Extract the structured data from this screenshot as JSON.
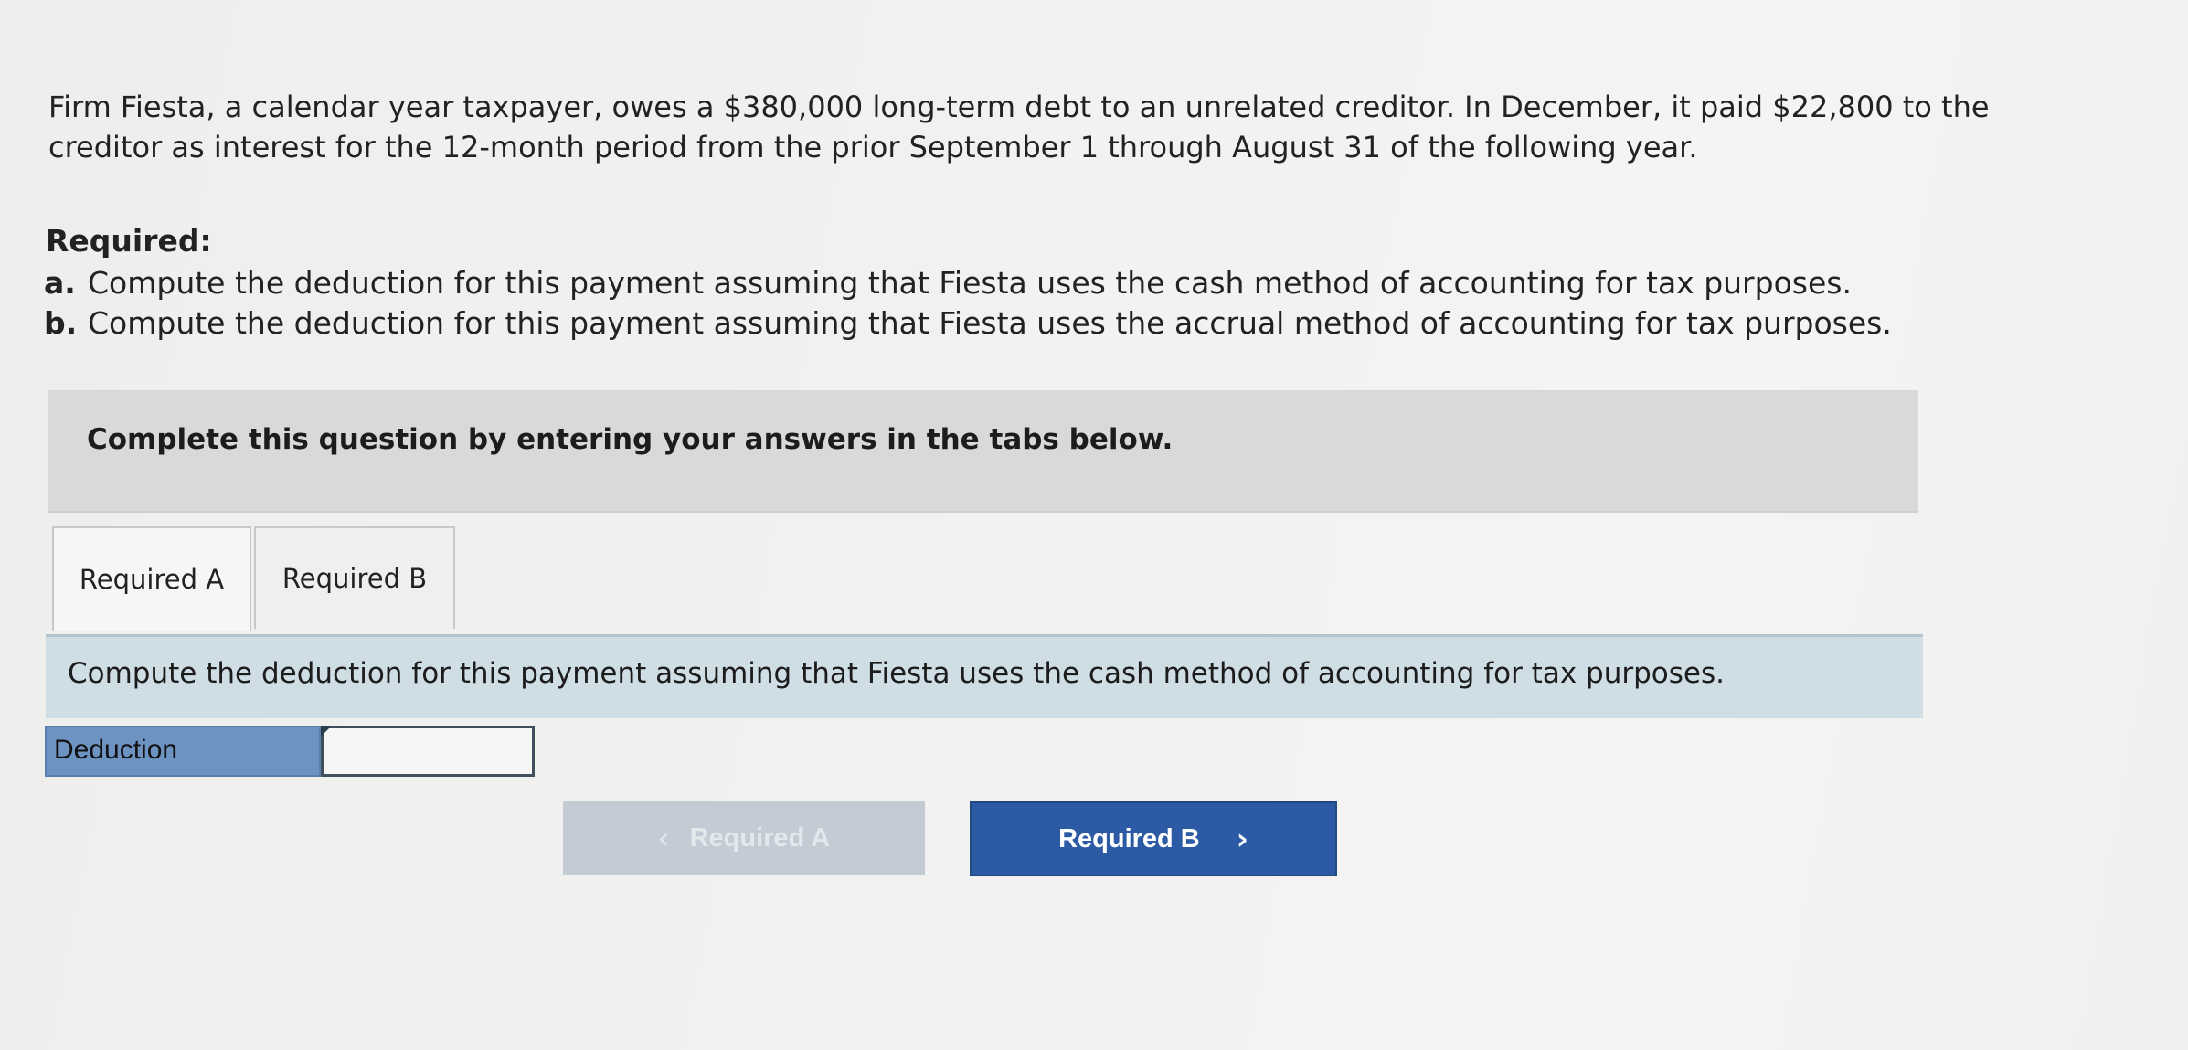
{
  "problem": {
    "line1": "Firm Fiesta, a calendar year taxpayer, owes a $380,000 long-term debt to an unrelated creditor. In December, it paid $22,800 to the",
    "line2": "creditor as interest for the 12-month period from the prior September 1 through August 31 of the following year."
  },
  "required": {
    "heading": "Required:",
    "items": [
      {
        "letter": "a.",
        "text": "Compute the deduction for this payment assuming that Fiesta uses the cash method of accounting for tax purposes."
      },
      {
        "letter": "b.",
        "text": "Compute the deduction for this payment assuming that Fiesta uses the accrual method of accounting for tax purposes."
      }
    ]
  },
  "instruction": "Complete this question by entering your answers in the tabs below.",
  "tabs": [
    {
      "label": "Required A",
      "active": true
    },
    {
      "label": "Required B",
      "active": false
    }
  ],
  "task": "Compute the deduction for this payment assuming that Fiesta uses the cash method of accounting for tax purposes.",
  "deduction": {
    "label": "Deduction",
    "value": ""
  },
  "nav": {
    "prev_label": "Required A",
    "prev_icon": "chevron-left-icon",
    "next_label": "Required B",
    "next_icon": "chevron-right-icon"
  },
  "colors": {
    "banner": "#d9d9d7",
    "task_panel": "#cfdde5",
    "label_cell": "#6d93c2",
    "next_button": "#2d5aa4",
    "prev_button_disabled": "#c3ccd4"
  }
}
